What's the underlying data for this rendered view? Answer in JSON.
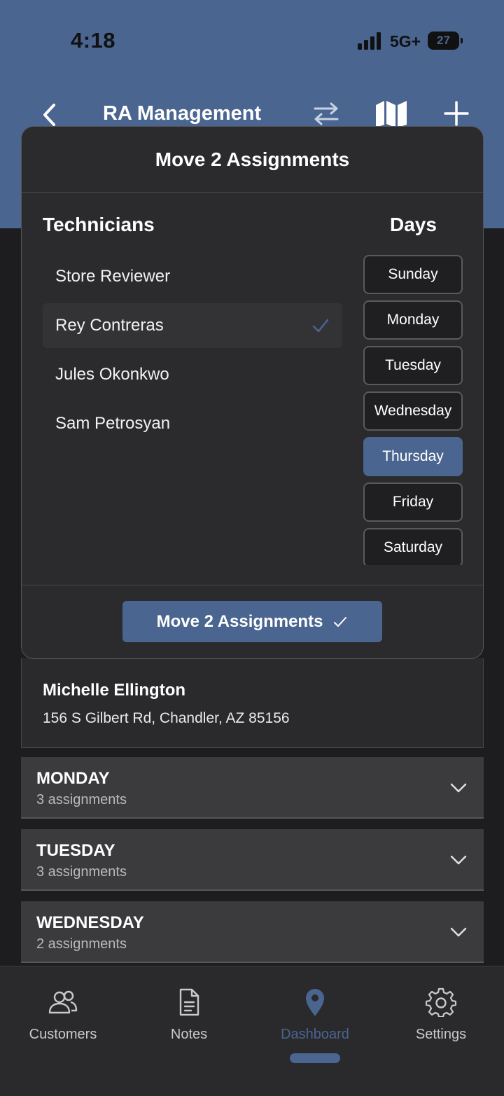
{
  "status_bar": {
    "time": "4:18",
    "network": "5G+",
    "battery": "27"
  },
  "header": {
    "title": "RA Management"
  },
  "modal": {
    "title": "Move 2 Assignments",
    "technicians_heading": "Technicians",
    "days_heading": "Days",
    "technicians": [
      {
        "name": "Store Reviewer",
        "selected": false
      },
      {
        "name": "Rey Contreras",
        "selected": true
      },
      {
        "name": "Jules Okonkwo",
        "selected": false
      },
      {
        "name": "Sam Petrosyan",
        "selected": false
      }
    ],
    "days": [
      {
        "label": "Sunday",
        "selected": false
      },
      {
        "label": "Monday",
        "selected": false
      },
      {
        "label": "Tuesday",
        "selected": false
      },
      {
        "label": "Wednesday",
        "selected": false
      },
      {
        "label": "Thursday",
        "selected": true
      },
      {
        "label": "Friday",
        "selected": false
      },
      {
        "label": "Saturday",
        "selected": false
      }
    ],
    "confirm_label": "Move 2 Assignments"
  },
  "customer": {
    "name": "Michelle Ellington",
    "address": "156 S Gilbert Rd, Chandler, AZ 85156"
  },
  "day_sections": [
    {
      "day": "MONDAY",
      "count": "3 assignments"
    },
    {
      "day": "TUESDAY",
      "count": "3 assignments"
    },
    {
      "day": "WEDNESDAY",
      "count": "2 assignments"
    }
  ],
  "tabs": [
    {
      "label": "Customers",
      "icon": "customers-icon",
      "active": false
    },
    {
      "label": "Notes",
      "icon": "notes-icon",
      "active": false
    },
    {
      "label": "Dashboard",
      "icon": "location-pin-icon",
      "active": true
    },
    {
      "label": "Settings",
      "icon": "gear-icon",
      "active": false
    }
  ],
  "colors": {
    "accent": "#4a6590",
    "surface": "#2b2b2e",
    "background": "#1d1d20",
    "section": "#3b3b3e"
  }
}
